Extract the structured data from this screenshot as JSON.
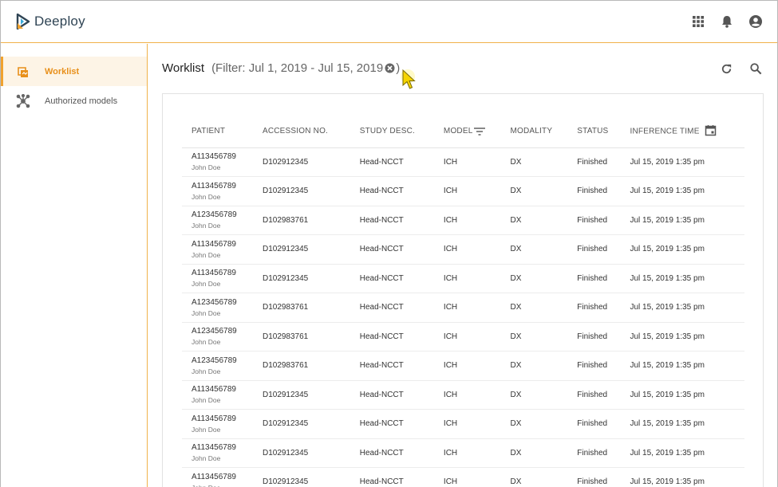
{
  "app": {
    "title": "Deeploy",
    "brand_color": "#f0a22e"
  },
  "header": {
    "icons": [
      "apps-grid-icon",
      "bell-icon",
      "account-icon"
    ]
  },
  "sidebar": {
    "items": [
      {
        "label": "Worklist",
        "icon": "worklist-icon",
        "active": true
      },
      {
        "label": "Authorized models",
        "icon": "models-network-icon",
        "active": false
      }
    ]
  },
  "main": {
    "title": "Worklist",
    "filter_text": "(Filter: Jul 1, 2019 - Jul 15, 2019",
    "filter_close": ")",
    "actions": [
      "refresh-icon",
      "search-icon"
    ]
  },
  "table": {
    "columns": [
      "PATIENT",
      "ACCESSION NO.",
      "STUDY DESC.",
      "MODEL",
      "MODALITY",
      "STATUS",
      "INFERENCE TIME"
    ],
    "rows": [
      {
        "patient_id": "A113456789",
        "patient_name": "John Doe",
        "accession": "D102912345",
        "study": "Head-NCCT",
        "model": "ICH",
        "modality": "DX",
        "status": "Finished",
        "time": "Jul 15, 2019 1:35 pm"
      },
      {
        "patient_id": "A113456789",
        "patient_name": "John Doe",
        "accession": "D102912345",
        "study": "Head-NCCT",
        "model": "ICH",
        "modality": "DX",
        "status": "Finished",
        "time": "Jul 15, 2019 1:35 pm"
      },
      {
        "patient_id": "A123456789",
        "patient_name": "John Doe",
        "accession": "D102983761",
        "study": "Head-NCCT",
        "model": "ICH",
        "modality": "DX",
        "status": "Finished",
        "time": "Jul 15, 2019 1:35 pm"
      },
      {
        "patient_id": "A113456789",
        "patient_name": "John Doe",
        "accession": "D102912345",
        "study": "Head-NCCT",
        "model": "ICH",
        "modality": "DX",
        "status": "Finished",
        "time": "Jul 15, 2019 1:35 pm"
      },
      {
        "patient_id": "A113456789",
        "patient_name": "John Doe",
        "accession": "D102912345",
        "study": "Head-NCCT",
        "model": "ICH",
        "modality": "DX",
        "status": "Finished",
        "time": "Jul 15, 2019 1:35 pm"
      },
      {
        "patient_id": "A123456789",
        "patient_name": "John Doe",
        "accession": "D102983761",
        "study": "Head-NCCT",
        "model": "ICH",
        "modality": "DX",
        "status": "Finished",
        "time": "Jul 15, 2019 1:35 pm"
      },
      {
        "patient_id": "A123456789",
        "patient_name": "John Doe",
        "accession": "D102983761",
        "study": "Head-NCCT",
        "model": "ICH",
        "modality": "DX",
        "status": "Finished",
        "time": "Jul 15, 2019 1:35 pm"
      },
      {
        "patient_id": "A123456789",
        "patient_name": "John Doe",
        "accession": "D102983761",
        "study": "Head-NCCT",
        "model": "ICH",
        "modality": "DX",
        "status": "Finished",
        "time": "Jul 15, 2019 1:35 pm"
      },
      {
        "patient_id": "A113456789",
        "patient_name": "John Doe",
        "accession": "D102912345",
        "study": "Head-NCCT",
        "model": "ICH",
        "modality": "DX",
        "status": "Finished",
        "time": "Jul 15, 2019 1:35 pm"
      },
      {
        "patient_id": "A113456789",
        "patient_name": "John Doe",
        "accession": "D102912345",
        "study": "Head-NCCT",
        "model": "ICH",
        "modality": "DX",
        "status": "Finished",
        "time": "Jul 15, 2019 1:35 pm"
      },
      {
        "patient_id": "A113456789",
        "patient_name": "John Doe",
        "accession": "D102912345",
        "study": "Head-NCCT",
        "model": "ICH",
        "modality": "DX",
        "status": "Finished",
        "time": "Jul 15, 2019 1:35 pm"
      },
      {
        "patient_id": "A113456789",
        "patient_name": "John Doe",
        "accession": "D102912345",
        "study": "Head-NCCT",
        "model": "ICH",
        "modality": "DX",
        "status": "Finished",
        "time": "Jul 15, 2019 1:35 pm"
      }
    ]
  }
}
